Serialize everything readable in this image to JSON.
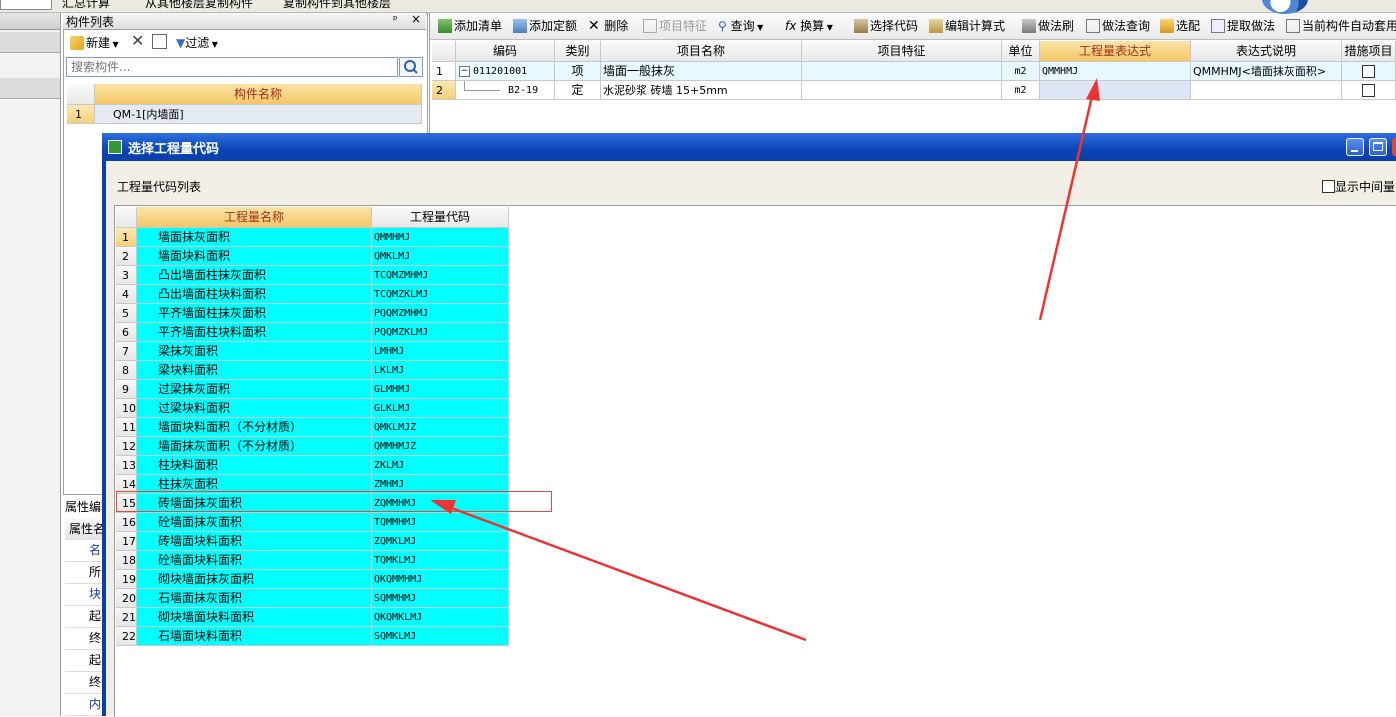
{
  "top_tabs": [
    "汇总计算",
    "从其他楼层复制构件",
    "复制构件到其他楼层"
  ],
  "left_panel": {
    "title": "构件列表",
    "pin": "ᵖ",
    "close": "×",
    "new_label": "新建",
    "filter_label": "过滤",
    "search_placeholder": "搜索构件...",
    "column_header": "构件名称",
    "rows": [
      {
        "num": "1",
        "name": "QM-1[内墙面]"
      }
    ]
  },
  "prop_panel": {
    "title": "属性编辑",
    "header": "属性名称",
    "items": [
      "名",
      "所",
      "块",
      "起",
      "终",
      "起",
      "终",
      "内"
    ]
  },
  "toolbar": {
    "add_list": "添加清单",
    "add_quota": "添加定额",
    "delete": "删除",
    "item_feature": "项目特征",
    "query": "查询",
    "convert": "换算",
    "select_code": "选择代码",
    "edit_formula": "编辑计算式",
    "method_brush": "做法刷",
    "method_query": "做法查询",
    "select_match": "选配",
    "extract_method": "提取做法",
    "auto_apply": "当前构件自动套用"
  },
  "main_table": {
    "columns": [
      "编码",
      "类别",
      "项目名称",
      "项目特征",
      "单位",
      "工程量表达式",
      "表达式说明",
      "措施项目"
    ],
    "rows": [
      {
        "num": "1",
        "code": "011201001",
        "type": "项",
        "name": "墙面一般抹灰",
        "feature": "",
        "unit": "m2",
        "expr": "QMMHMJ",
        "desc": "QMMHMJ<墙面抹灰面积>"
      },
      {
        "num": "2",
        "code": "B2-19",
        "type": "定",
        "name": "水泥砂浆 砖墙 15+5mm",
        "feature": "",
        "unit": "m2",
        "expr": "",
        "desc": ""
      }
    ]
  },
  "dialog": {
    "title": "选择工程量代码",
    "list_label": "工程量代码列表",
    "show_intermediate": "显示中间量",
    "col_name": "工程量名称",
    "col_code": "工程量代码",
    "rows": [
      {
        "num": "1",
        "name": "墙面抹灰面积",
        "code": "QMMHMJ"
      },
      {
        "num": "2",
        "name": "墙面块料面积",
        "code": "QMKLMJ"
      },
      {
        "num": "3",
        "name": "凸出墙面柱抹灰面积",
        "code": "TCQMZMHMJ"
      },
      {
        "num": "4",
        "name": "凸出墙面柱块料面积",
        "code": "TCQMZKLMJ"
      },
      {
        "num": "5",
        "name": "平齐墙面柱抹灰面积",
        "code": "PQQMZMHMJ"
      },
      {
        "num": "6",
        "name": "平齐墙面柱块料面积",
        "code": "PQQMZKLMJ"
      },
      {
        "num": "7",
        "name": "梁抹灰面积",
        "code": "LMHMJ"
      },
      {
        "num": "8",
        "name": "梁块料面积",
        "code": "LKLMJ"
      },
      {
        "num": "9",
        "name": "过梁抹灰面积",
        "code": "GLMHMJ"
      },
      {
        "num": "10",
        "name": "过梁块料面积",
        "code": "GLKLMJ"
      },
      {
        "num": "11",
        "name": "墙面块料面积（不分材质）",
        "code": "QMKLMJZ"
      },
      {
        "num": "12",
        "name": "墙面抹灰面积（不分材质）",
        "code": "QMMHMJZ"
      },
      {
        "num": "13",
        "name": "柱块料面积",
        "code": "ZKLMJ"
      },
      {
        "num": "14",
        "name": "柱抹灰面积",
        "code": "ZMHMJ"
      },
      {
        "num": "15",
        "name": "砖墙面抹灰面积",
        "code": "ZQMMHMJ"
      },
      {
        "num": "16",
        "name": "砼墙面抹灰面积",
        "code": "TQMMHMJ"
      },
      {
        "num": "17",
        "name": "砖墙面块料面积",
        "code": "ZQMKLMJ"
      },
      {
        "num": "18",
        "name": "砼墙面块料面积",
        "code": "TQMKLMJ"
      },
      {
        "num": "19",
        "name": "砌块墙面抹灰面积",
        "code": "QKQMMHMJ"
      },
      {
        "num": "20",
        "name": "石墙面抹灰面积",
        "code": "SQMMHMJ"
      },
      {
        "num": "21",
        "name": "砌块墙面块料面积",
        "code": "QKQMKLMJ"
      },
      {
        "num": "22",
        "name": "石墙面块料面积",
        "code": "SQMKLMJ"
      }
    ]
  },
  "colors": {
    "cyan_fill": "#00ffff",
    "title_bar": "#0a3fa8",
    "annotation_red": "#ee3333"
  }
}
